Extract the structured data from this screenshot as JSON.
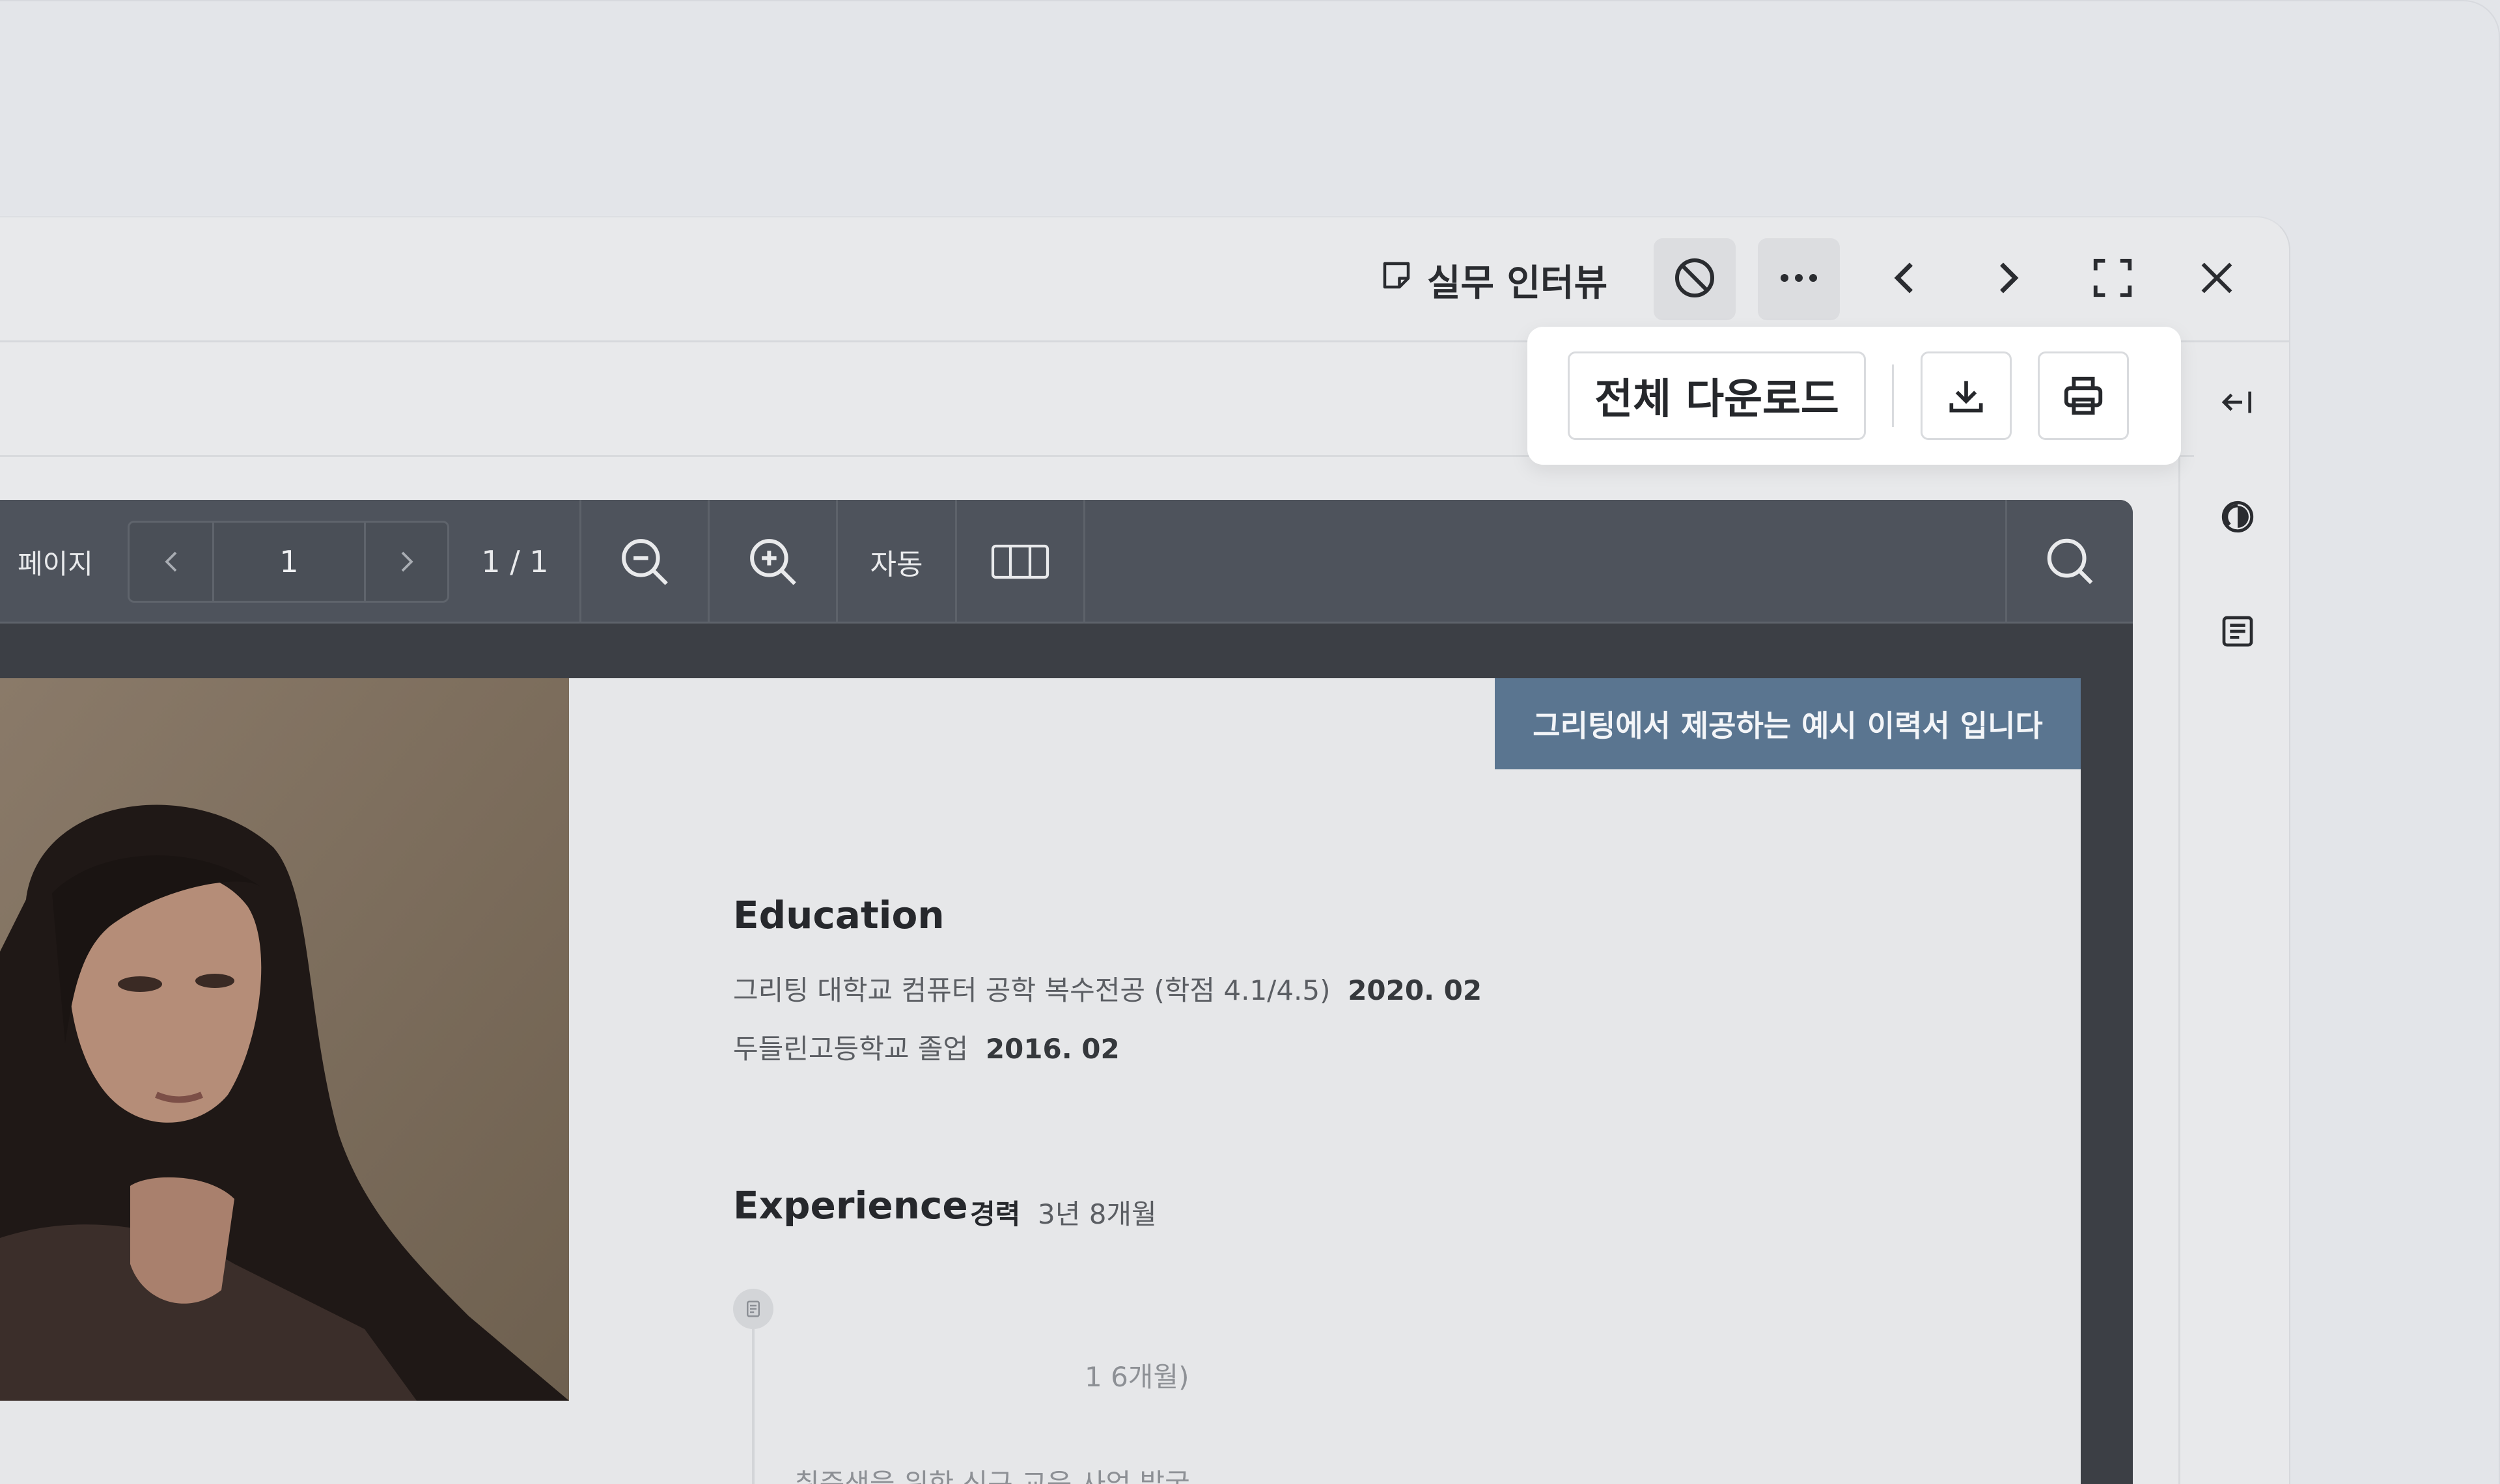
{
  "toolbar": {
    "memo_label": "실무 인터뷰",
    "icons": [
      "memo-icon",
      "block-icon",
      "more-icon",
      "chevron-left-icon",
      "chevron-right-icon",
      "fullscreen-icon",
      "close-icon"
    ]
  },
  "download_popup": {
    "download_all_label": "전체 다운로드",
    "icons": [
      "download-icon",
      "print-icon"
    ]
  },
  "side_panel": {
    "icons": [
      "collapse-left-icon",
      "contrast-icon",
      "document-icon"
    ]
  },
  "viewer": {
    "page_label": "페이지",
    "page_input": "1",
    "page_count": "1 / 1",
    "zoom_mode": "자동"
  },
  "resume": {
    "banner": "그리팅에서 제공하는 예시 이력서 입니다",
    "education_heading": "Education",
    "education": [
      {
        "text": "그리팅 대학교 컴퓨터 공학 복수전공 (학점 4.1/4.5)",
        "date": "2020. 02"
      },
      {
        "text": "두들린고등학교 졸업",
        "date": "2016. 02"
      }
    ],
    "experience_heading": "Experience",
    "experience_label": "경력",
    "experience_duration": "3년 8개월",
    "experience_fragment": "1 6개월)",
    "experience_line": "취준생을 위한 신규 교육 사업 발굴"
  },
  "colors": {
    "banner": "#5a7590",
    "viewer_toolbar": "#4e535c",
    "viewer_bg": "#3c3f45"
  }
}
